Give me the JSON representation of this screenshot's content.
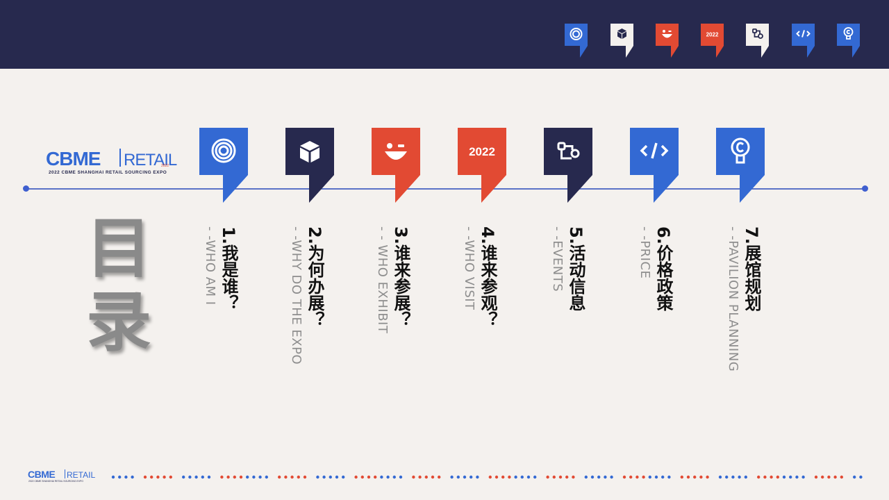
{
  "colors": {
    "navy": "#27294e",
    "blue": "#3369d3",
    "red": "#e24a33",
    "cream": "#f4f1ee",
    "line": "#5a72c6"
  },
  "brand": {
    "name": "CBME",
    "sub": "RETAIL",
    "year_small": "2022",
    "tagline": "2022 CBME SHANGHAI RETAIL SOURCING EXPO"
  },
  "title": "目录",
  "nav_icons": [
    {
      "icon": "target-icon",
      "color": "blue"
    },
    {
      "icon": "cube-icon",
      "color": "cream"
    },
    {
      "icon": "smiley-icon",
      "color": "red"
    },
    {
      "icon": "year-icon",
      "label": "2022",
      "color": "red"
    },
    {
      "icon": "workflow-icon",
      "color": "cream"
    },
    {
      "icon": "code-icon",
      "color": "blue"
    },
    {
      "icon": "lightbulb-icon",
      "color": "blue"
    }
  ],
  "menu": [
    {
      "cn": "1.我是谁？",
      "en": "- -WHO AM I",
      "icon": "target-icon",
      "color": "blue"
    },
    {
      "cn": "2.为何办展？",
      "en": "- -WHY DO THE EXPO",
      "icon": "cube-icon",
      "color": "navy"
    },
    {
      "cn": "3.谁来参展？",
      "en": "- - WHO EXHIBIT",
      "icon": "smiley-icon",
      "color": "red"
    },
    {
      "cn": "4.谁来参观？",
      "en": "- -WHO VISIT",
      "icon": "year-icon",
      "label": "2022",
      "color": "red"
    },
    {
      "cn": "5.活动信息",
      "en": "- -EVENTS",
      "icon": "workflow-icon",
      "color": "navy"
    },
    {
      "cn": "6.价格政策",
      "en": "- -PRICE",
      "icon": "code-icon",
      "color": "blue"
    },
    {
      "cn": "7.展馆规划",
      "en": "- -PAVILION PLANNING",
      "icon": "lightbulb-icon",
      "color": "blue"
    }
  ]
}
